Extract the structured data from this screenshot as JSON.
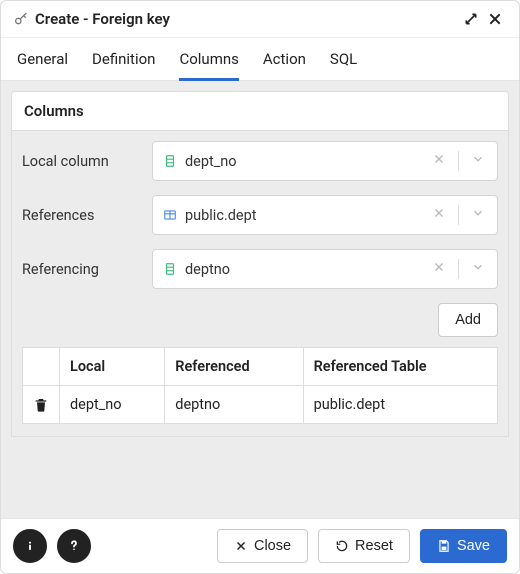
{
  "title": "Create - Foreign key",
  "tabs": [
    "General",
    "Definition",
    "Columns",
    "Action",
    "SQL"
  ],
  "active_tab_index": 2,
  "panel_title": "Columns",
  "form": {
    "local_column": {
      "label": "Local column",
      "value": "dept_no"
    },
    "references": {
      "label": "References",
      "value": "public.dept"
    },
    "referencing": {
      "label": "Referencing",
      "value": "deptno"
    }
  },
  "add_button": "Add",
  "table": {
    "headers": [
      "Local",
      "Referenced",
      "Referenced Table"
    ],
    "rows": [
      {
        "local": "dept_no",
        "referenced": "deptno",
        "ref_table": "public.dept"
      }
    ]
  },
  "footer": {
    "close": "Close",
    "reset": "Reset",
    "save": "Save"
  }
}
